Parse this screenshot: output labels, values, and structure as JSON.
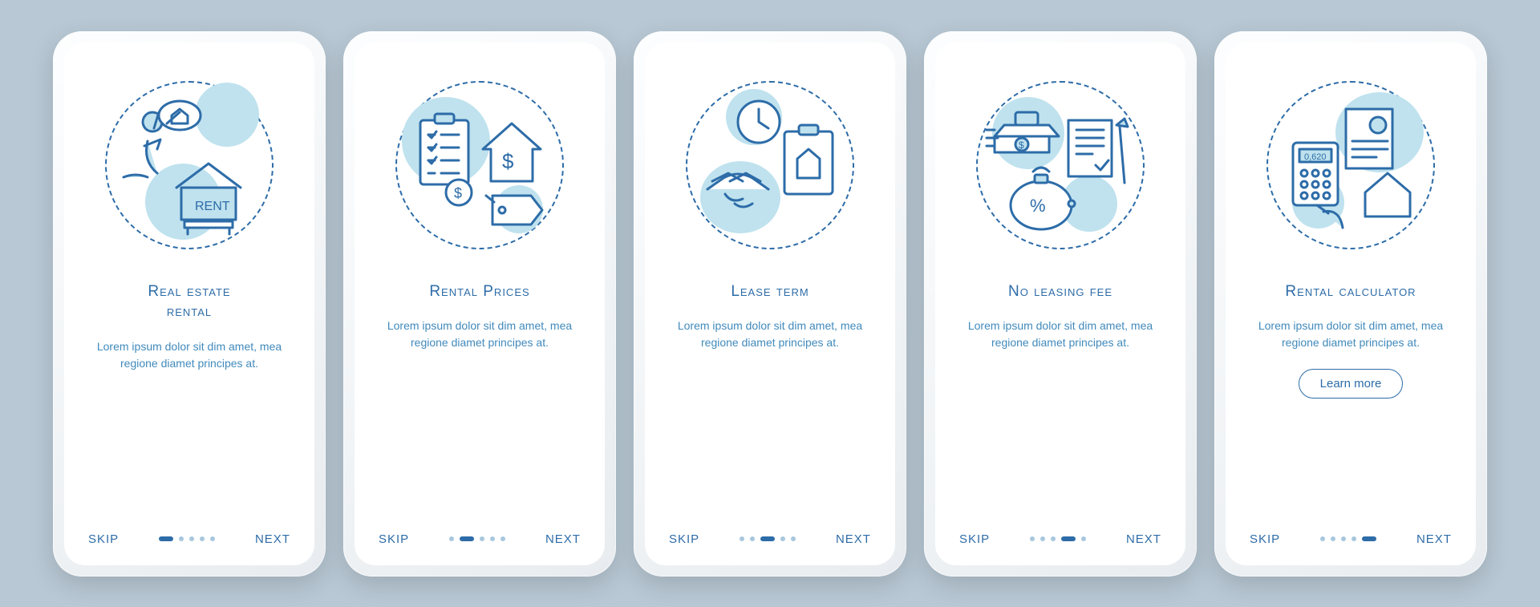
{
  "common": {
    "skip": "SKIP",
    "next": "NEXT",
    "desc": "Lorem ipsum dolor sit dim amet, mea regione diamet principes at.",
    "learn": "Learn more"
  },
  "screens": [
    {
      "title": "Real estate\nrental",
      "idx": 0
    },
    {
      "title": "Rental Prices",
      "idx": 1
    },
    {
      "title": "Lease term",
      "idx": 2
    },
    {
      "title": "No leasing fee",
      "idx": 3
    },
    {
      "title": "Rental calculator",
      "idx": 4,
      "cta": true
    }
  ],
  "colors": {
    "accent": "#2d6ca8",
    "light": "#bfe2ee"
  }
}
